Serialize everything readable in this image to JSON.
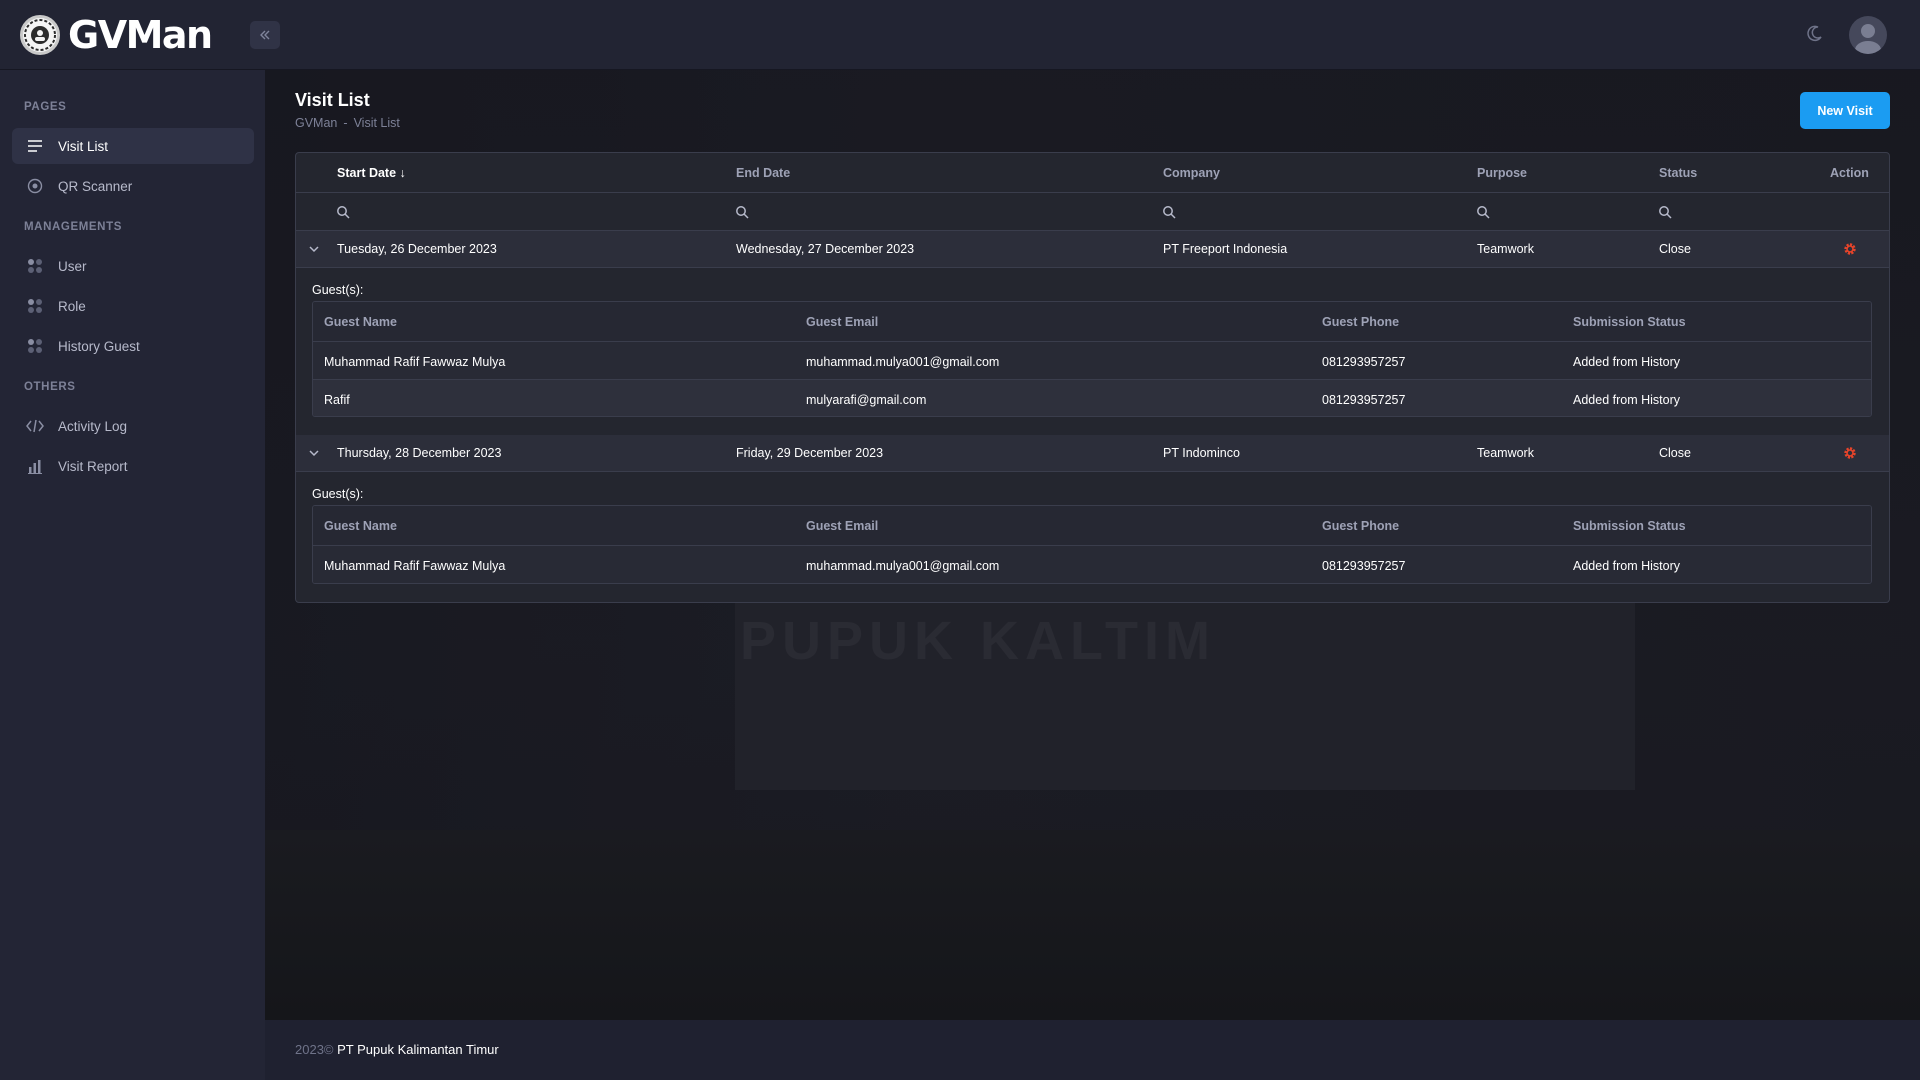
{
  "app": {
    "name": "GVMan",
    "brand_color": "#1b9cf2",
    "accent_gear": "#e8442a"
  },
  "sidebar": {
    "sections": [
      {
        "label": "PAGES"
      },
      {
        "label": "MANAGEMENTS"
      },
      {
        "label": "OTHERS"
      }
    ],
    "items": [
      {
        "label": "Visit List",
        "icon": "list-icon",
        "active": true
      },
      {
        "label": "QR Scanner",
        "icon": "qr-scanner-icon",
        "active": false
      },
      {
        "label": "User",
        "icon": "grid-dots-icon",
        "active": false
      },
      {
        "label": "Role",
        "icon": "grid-dots-icon",
        "active": false
      },
      {
        "label": "History Guest",
        "icon": "grid-dots-icon",
        "active": false
      },
      {
        "label": "Activity Log",
        "icon": "code-icon",
        "active": false
      },
      {
        "label": "Visit Report",
        "icon": "bar-chart-icon",
        "active": false
      }
    ]
  },
  "page": {
    "title": "Visit List",
    "breadcrumb": [
      "GVMan",
      "Visit List"
    ],
    "breadcrumb_sep": "-",
    "new_visit_label": "New Visit"
  },
  "table": {
    "columns": [
      "Start Date",
      "End Date",
      "Company",
      "Purpose",
      "Status",
      "Action"
    ],
    "sort_indicator": "↓",
    "guests_label": "Guest(s):",
    "guest_columns": [
      "Guest Name",
      "Guest Email",
      "Guest Phone",
      "Submission Status"
    ],
    "visits": [
      {
        "start": "Tuesday, 26 December 2023",
        "end": "Wednesday, 27 December 2023",
        "company": "PT Freeport Indonesia",
        "purpose": "Teamwork",
        "status": "Close",
        "guests": [
          {
            "name": "Muhammad Rafif Fawwaz Mulya",
            "email": "muhammad.mulya001@gmail.com",
            "phone": "081293957257",
            "submission": "Added from History"
          },
          {
            "name": "Rafif",
            "email": "mulyarafi@gmail.com",
            "phone": "081293957257",
            "submission": "Added from History"
          }
        ]
      },
      {
        "start": "Thursday, 28 December 2023",
        "end": "Friday, 29 December 2023",
        "company": "PT Indominco",
        "purpose": "Teamwork",
        "status": "Close",
        "guests": [
          {
            "name": "Muhammad Rafif Fawwaz Mulya",
            "email": "muhammad.mulya001@gmail.com",
            "phone": "081293957257",
            "submission": "Added from History"
          }
        ]
      }
    ]
  },
  "background": {
    "sign_text": "PUPUK KALTIM"
  },
  "footer": {
    "year": "2023©",
    "company": "PT Pupuk Kalimantan Timur"
  }
}
